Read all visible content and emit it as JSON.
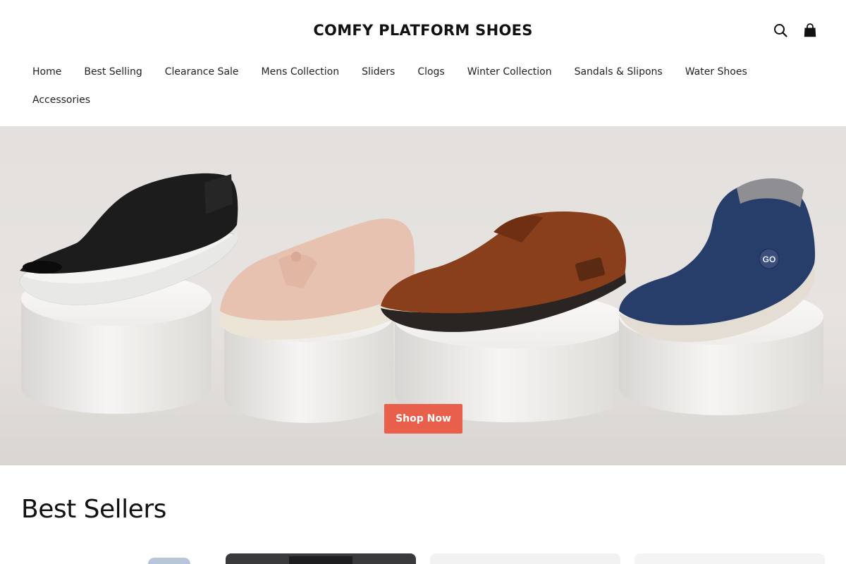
{
  "brand": {
    "logo_text": "COMFY PLATFORM SHOES"
  },
  "header": {
    "icons": [
      "search-icon",
      "cart-bag-icon"
    ]
  },
  "nav": {
    "items": [
      {
        "label": "Home"
      },
      {
        "label": "Best Selling"
      },
      {
        "label": "Clearance Sale"
      },
      {
        "label": "Mens Collection"
      },
      {
        "label": "Sliders"
      },
      {
        "label": "Clogs"
      },
      {
        "label": "Winter Collection"
      },
      {
        "label": "Sandals & Slipons"
      },
      {
        "label": "Water Shoes"
      },
      {
        "label": "Accessories"
      }
    ]
  },
  "hero": {
    "cta_label": "Shop Now",
    "badge_text": "GO"
  },
  "best_sellers": {
    "title": "Best Sellers"
  },
  "colors": {
    "accent": "#e8604c",
    "hero_bg": "#e3e0dd"
  }
}
